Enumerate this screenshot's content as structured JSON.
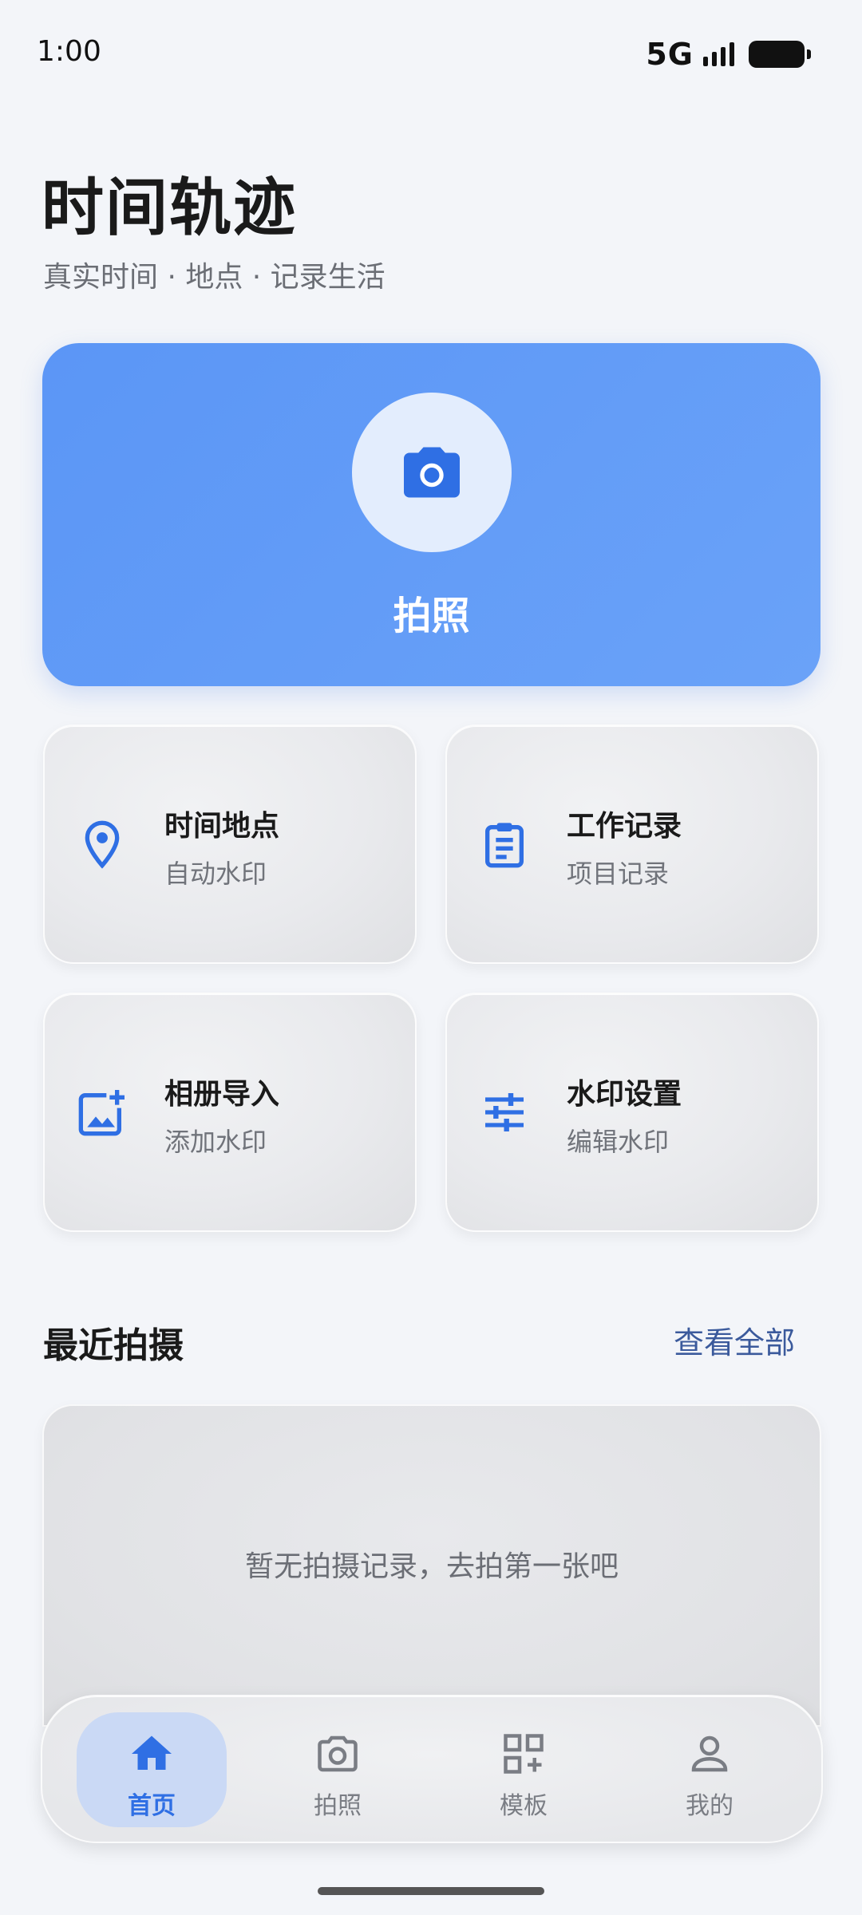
{
  "status_bar": {
    "time": "1:00",
    "network": "5G"
  },
  "header": {
    "title": "时间轨迹",
    "subtitle": "真实时间 · 地点 · 记录生活"
  },
  "hero": {
    "label": "拍照",
    "icon": "camera-icon",
    "color": "#5b96f6"
  },
  "features": [
    {
      "title": "时间地点",
      "desc": "自动水印",
      "icon": "location-pin-icon"
    },
    {
      "title": "工作记录",
      "desc": "项目记录",
      "icon": "clipboard-icon"
    },
    {
      "title": "相册导入",
      "desc": "添加水印",
      "icon": "add-photo-icon"
    },
    {
      "title": "水印设置",
      "desc": "编辑水印",
      "icon": "sliders-icon"
    }
  ],
  "recent": {
    "title": "最近拍摄",
    "view_all": "查看全部",
    "empty": "暂无拍摄记录，去拍第一张吧"
  },
  "nav": [
    {
      "label": "首页",
      "icon": "home-icon",
      "active": true
    },
    {
      "label": "拍照",
      "icon": "camera-outline-icon"
    },
    {
      "label": "模板",
      "icon": "template-grid-icon"
    },
    {
      "label": "我的",
      "icon": "person-icon"
    }
  ],
  "colors": {
    "accent": "#2f6fe4",
    "background": "#f3f5f9"
  }
}
